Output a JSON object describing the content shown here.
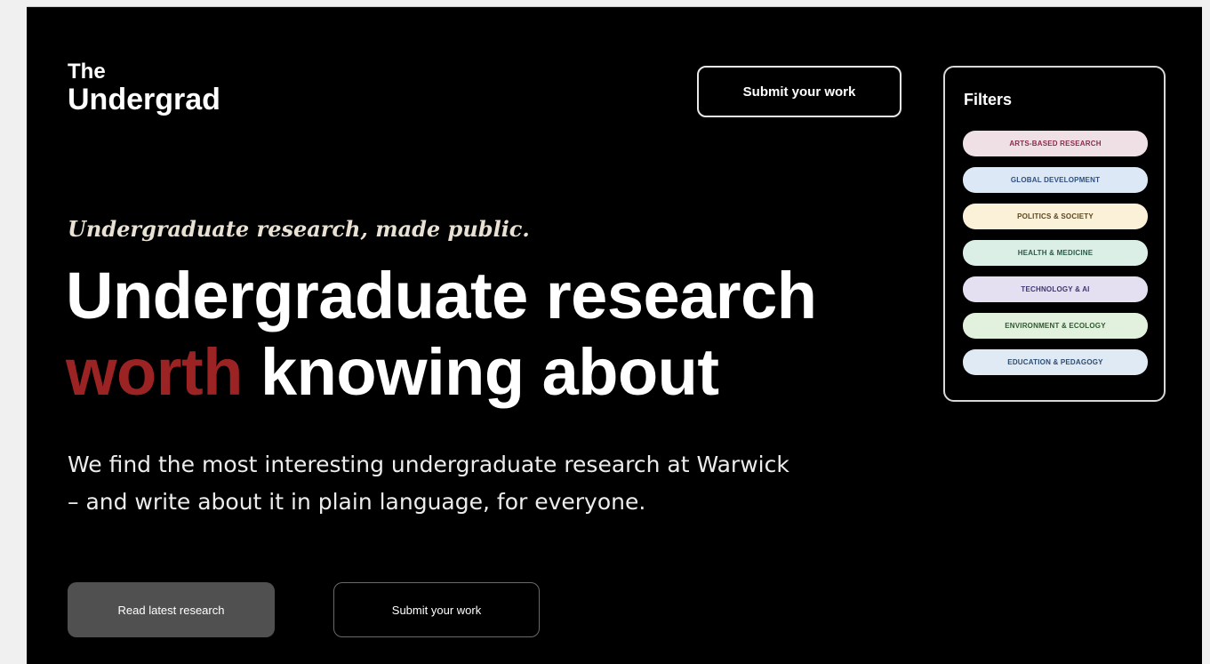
{
  "brand": {
    "line1": "The",
    "line2": "Undergrad"
  },
  "header": {
    "submit_label": "Submit your work"
  },
  "hero": {
    "tagline": "Undergraduate research, made public.",
    "headline_line1": "Undergraduate research",
    "headline_accent": "worth",
    "headline_rest": " knowing about",
    "intro_line1": "We find the most interesting undergraduate research at Warwick",
    "intro_line2": "– and write about it in plain language, for everyone.",
    "primary_label": "Read latest research",
    "secondary_label": "Submit your work"
  },
  "filters": {
    "title": "Filters",
    "items": [
      {
        "label": "ARTS-BASED RESEARCH",
        "bg": "#efe0e6",
        "fg": "#8a2c48"
      },
      {
        "label": "GLOBAL DEVELOPMENT",
        "bg": "#dde8f6",
        "fg": "#2d4f80"
      },
      {
        "label": "POLITICS & SOCIETY",
        "bg": "#fbf0d8",
        "fg": "#5a4820"
      },
      {
        "label": "HEALTH & MEDICINE",
        "bg": "#dcefe7",
        "fg": "#2d5a48"
      },
      {
        "label": "TECHNOLOGY & AI",
        "bg": "#e4e0f2",
        "fg": "#3e3670"
      },
      {
        "label": "ENVIRONMENT & ECOLOGY",
        "bg": "#e2f0de",
        "fg": "#2f5a30"
      },
      {
        "label": "EDUCATION & PEDAGOGY",
        "bg": "#dfeaf5",
        "fg": "#2c4c72"
      }
    ]
  },
  "colors": {
    "background": "#000000",
    "accent": "#9b2323",
    "primary_button": "#505050"
  }
}
